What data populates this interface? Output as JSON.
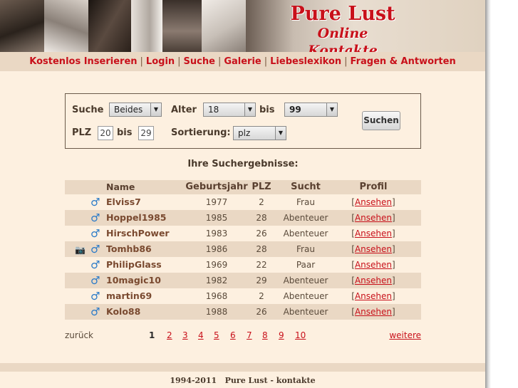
{
  "brand": {
    "title": "Pure Lust",
    "subtitle": "Online Kontakte"
  },
  "nav": {
    "items": [
      "Kostenlos Inserieren",
      "Login",
      "Suche",
      "Galerie",
      "Liebeslexikon",
      "Fragen & Antworten"
    ],
    "separator": "|"
  },
  "search": {
    "suche_label": "Suche",
    "suche_value": "Beides",
    "alter_label": "Alter",
    "alter_from": "18",
    "bis_label": "bis",
    "alter_to": "99",
    "plz_label": "PLZ",
    "plz_from": "20",
    "plz_bis_label": "bis",
    "plz_to": "29",
    "sort_label": "Sortierung:",
    "sort_value": "plz",
    "submit_label": "Suchen"
  },
  "results": {
    "title": "Ihre Suchergebnisse:",
    "columns": {
      "name": "Name",
      "year": "Geburtsjahr",
      "plz": "PLZ",
      "sucht": "Sucht",
      "profil": "Profil"
    },
    "link_label": "Ansehen",
    "rows": [
      {
        "name": "Elviss7",
        "year": "1977",
        "plz": "2",
        "sucht": "Frau",
        "photo": false
      },
      {
        "name": "Hoppel1985",
        "year": "1985",
        "plz": "28",
        "sucht": "Abenteuer",
        "photo": false
      },
      {
        "name": "HirschPower",
        "year": "1983",
        "plz": "26",
        "sucht": "Abenteuer",
        "photo": false
      },
      {
        "name": "Tomhb86",
        "year": "1986",
        "plz": "28",
        "sucht": "Frau",
        "photo": true
      },
      {
        "name": "PhilipGlass",
        "year": "1969",
        "plz": "22",
        "sucht": "Paar",
        "photo": false
      },
      {
        "name": "10magic10",
        "year": "1982",
        "plz": "29",
        "sucht": "Abenteuer",
        "photo": false
      },
      {
        "name": "martin69",
        "year": "1968",
        "plz": "2",
        "sucht": "Abenteuer",
        "photo": false
      },
      {
        "name": "Kolo88",
        "year": "1988",
        "plz": "26",
        "sucht": "Abenteuer",
        "photo": false
      }
    ]
  },
  "pager": {
    "prev": "zurück",
    "pages": [
      "1",
      "2",
      "3",
      "4",
      "5",
      "6",
      "7",
      "8",
      "9",
      "10"
    ],
    "current": "1",
    "next": "weitere"
  },
  "footer": {
    "text": "1994-2011   Pure Lust - kontakte"
  },
  "colors": {
    "accent": "#c8101a",
    "page_bg": "#fdf0e0",
    "band": "#ead8c4",
    "male_icon": "#2a7ac8"
  },
  "icons": {
    "male": "male-symbol-icon",
    "camera": "camera-icon"
  }
}
